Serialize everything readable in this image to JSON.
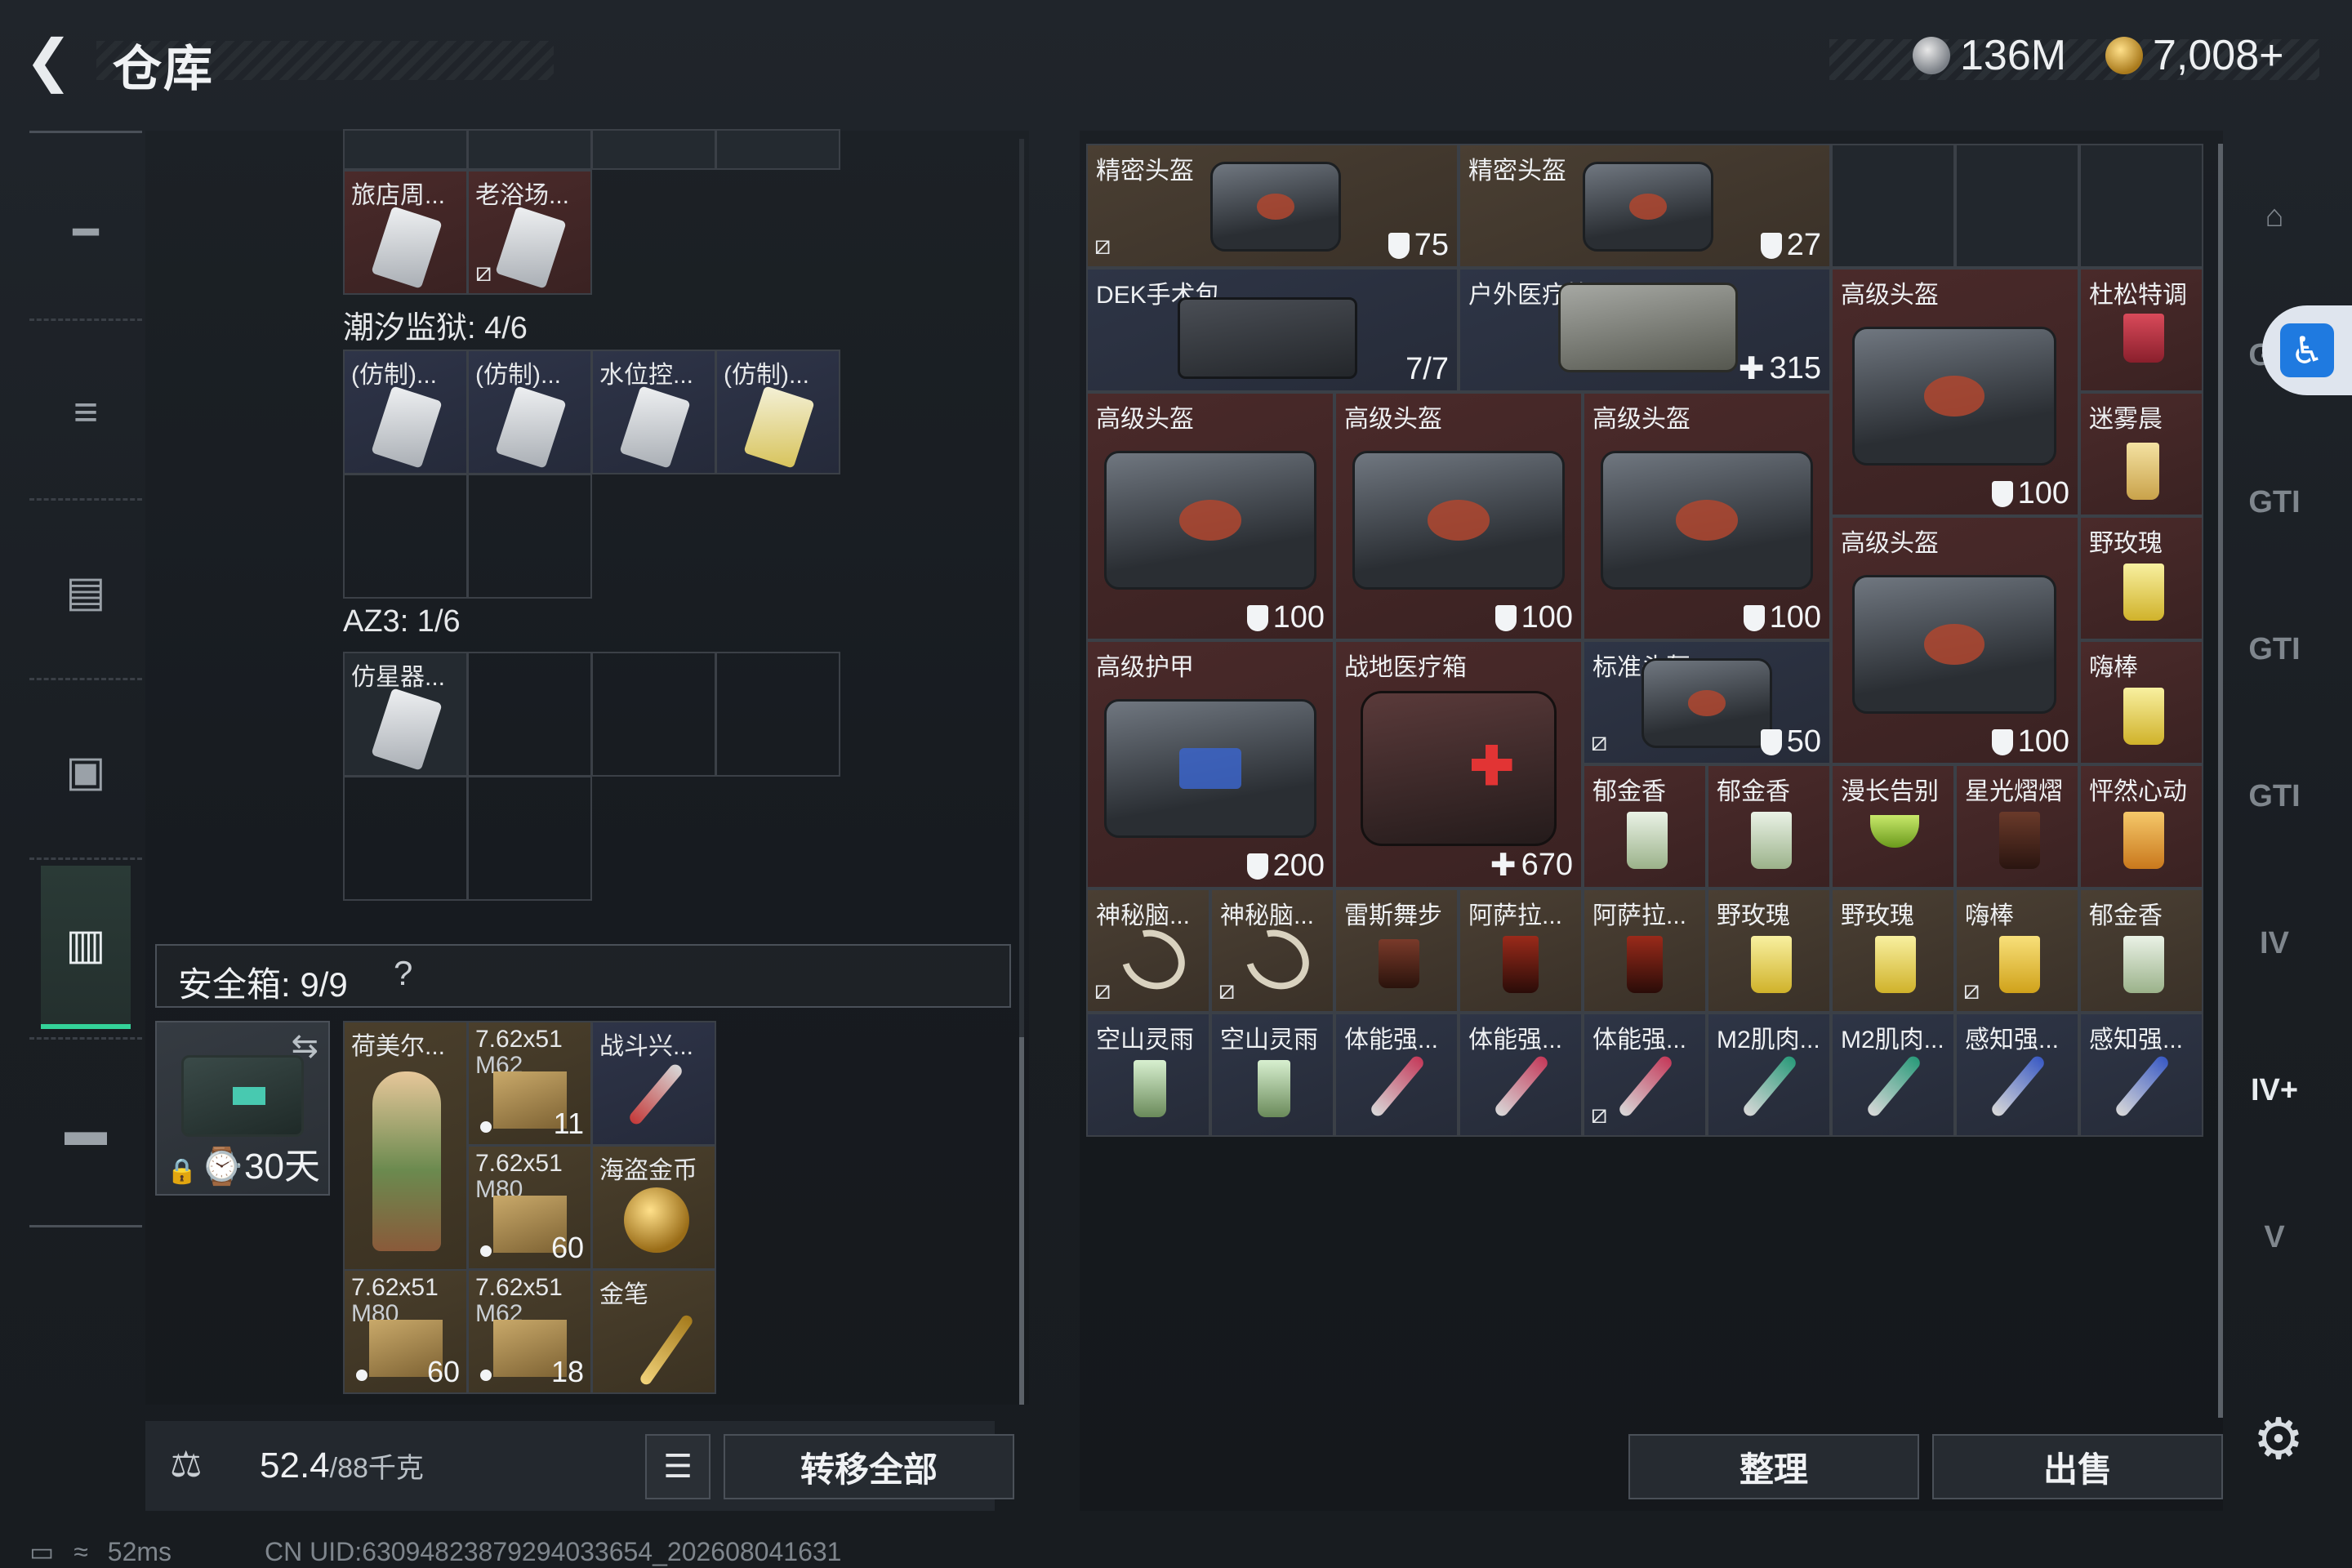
{
  "header": {
    "title": "仓库",
    "silver": "136M",
    "gold": "7,008+"
  },
  "left": {
    "top_partial": [],
    "row1": [
      {
        "name": "旅店周...",
        "noicon": false
      },
      {
        "name": "老浴场...",
        "noicon": true
      }
    ],
    "tide": {
      "label": "潮汐监狱: 4/6",
      "items": [
        "(仿制)...",
        "(仿制)...",
        "水位控...",
        "(仿制)..."
      ]
    },
    "az3": {
      "label": "AZ3: 1/6",
      "items": [
        "仿星器..."
      ]
    },
    "safe": {
      "label": "安全箱: 9/9",
      "help": "?",
      "days": "30天",
      "items": [
        {
          "name": "荷美尔..."
        },
        {
          "name": "7.62x51",
          "sub": "M62",
          "qty": "11"
        },
        {
          "name": "战斗兴..."
        },
        {
          "name": "7.62x51",
          "sub": "M80",
          "qty": "60"
        },
        {
          "name": "海盗金币"
        },
        {
          "name": "7.62x51",
          "sub": "M80",
          "qty": "60"
        },
        {
          "name": "7.62x51",
          "sub": "M62",
          "qty": "18"
        },
        {
          "name": "金笔"
        }
      ]
    },
    "weight": {
      "value": "52.4",
      "unit": "/88千克"
    },
    "transfer_label": "转移全部"
  },
  "right": {
    "items": [
      {
        "name": "精密头盔",
        "dur": "75"
      },
      {
        "name": "精密头盔",
        "dur": "27"
      },
      {
        "name": "DEK手术包",
        "dur": "7/7"
      },
      {
        "name": "户外医疗箱",
        "dur": "315"
      },
      {
        "name": "高级头盔",
        "dur": "100"
      },
      {
        "name": "杜松特调"
      },
      {
        "name": "迷雾晨"
      },
      {
        "name": "高级头盔",
        "dur": "100"
      },
      {
        "name": "高级头盔",
        "dur": "100"
      },
      {
        "name": "高级头盔",
        "dur": "100"
      },
      {
        "name": "高级头盔",
        "dur": "100"
      },
      {
        "name": "野玫瑰"
      },
      {
        "name": "嗨棒"
      },
      {
        "name": "高级护甲",
        "dur": "200"
      },
      {
        "name": "战地医疗箱",
        "dur": "670"
      },
      {
        "name": "标准头盔",
        "dur": "50"
      },
      {
        "name": "郁金香"
      },
      {
        "name": "郁金香"
      },
      {
        "name": "漫长告别"
      },
      {
        "name": "星光熠熠"
      },
      {
        "name": "怦然心动"
      },
      {
        "name": "神秘脑..."
      },
      {
        "name": "神秘脑..."
      },
      {
        "name": "雷斯舞步"
      },
      {
        "name": "阿萨拉..."
      },
      {
        "name": "阿萨拉..."
      },
      {
        "name": "野玫瑰"
      },
      {
        "name": "野玫瑰"
      },
      {
        "name": "嗨棒"
      },
      {
        "name": "郁金香"
      },
      {
        "name": "空山灵雨"
      },
      {
        "name": "空山灵雨"
      },
      {
        "name": "体能强..."
      },
      {
        "name": "体能强..."
      },
      {
        "name": "体能强..."
      },
      {
        "name": "M2肌肉..."
      },
      {
        "name": "M2肌肉..."
      },
      {
        "name": "感知强..."
      },
      {
        "name": "感知强..."
      }
    ],
    "sort_label": "整理",
    "sell_label": "出售"
  },
  "status": {
    "ping": "52ms",
    "uid": "CN UID:63094823879294033654_202608041631"
  }
}
